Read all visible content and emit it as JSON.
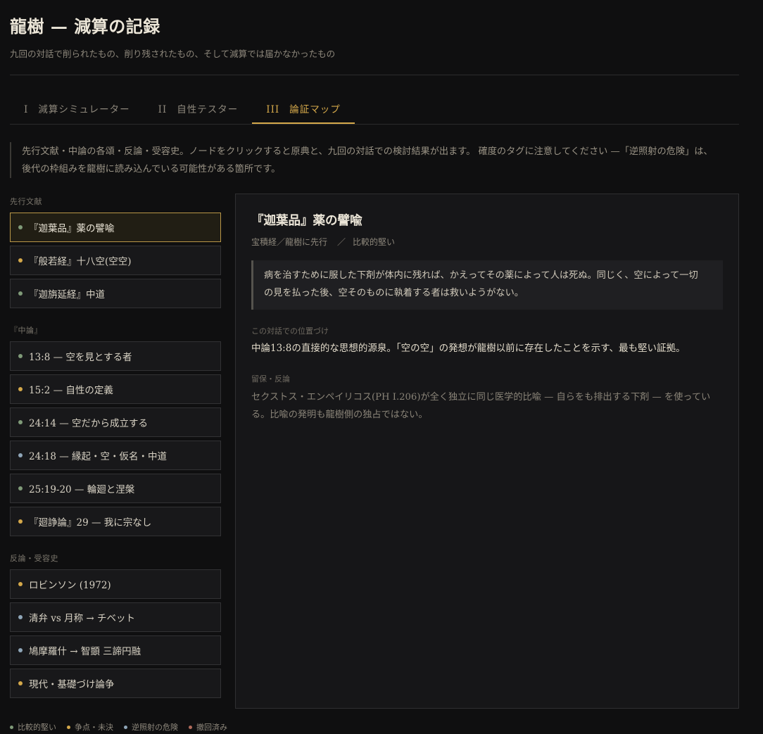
{
  "header": {
    "title": "龍樹 — 減算の記録",
    "subtitle": "九回の対話で削られたもの、削り残されたもの、そして減算では届かなかったもの"
  },
  "tabs": [
    {
      "num": "I",
      "label": "減算シミュレーター"
    },
    {
      "num": "II",
      "label": "自性テスター"
    },
    {
      "num": "III",
      "label": "論証マップ"
    }
  ],
  "intro": {
    "line1": "先行文献・中論の各頌・反論・受容史。ノードをクリックすると原典と、九回の対話での検討結果が出ます。 確度のタグに注意してください —「逆照射の危険」は、",
    "line2": "後代の枠組みを龍樹に読み込んでいる可能性がある箇所です。"
  },
  "colors": {
    "firm": "#7f9a78",
    "disputed": "#d4a84a",
    "risk": "#8fa6b8",
    "retracted": "#b06a5a",
    "accent": "#d4a84a"
  },
  "sections": [
    {
      "heading": "先行文献",
      "nodes": [
        {
          "label": "『迦葉品』薬の譬喩",
          "status": "firm"
        },
        {
          "label": "『般若経』十八空(空空)",
          "status": "disputed"
        },
        {
          "label": "『迦旃延経』中道",
          "status": "firm"
        }
      ]
    },
    {
      "heading": "『中論』",
      "nodes": [
        {
          "label": "13:8 — 空を見とする者",
          "status": "firm"
        },
        {
          "label": "15:2 — 自性の定義",
          "status": "disputed"
        },
        {
          "label": "24:14 — 空だから成立する",
          "status": "firm"
        },
        {
          "label": "24:18 — 縁起・空・仮名・中道",
          "status": "risk"
        },
        {
          "label": "25:19-20 — 輪廻と涅槃",
          "status": "firm"
        },
        {
          "label": "『廻諍論』29 — 我に宗なし",
          "status": "disputed"
        }
      ]
    },
    {
      "heading": "反論・受容史",
      "nodes": [
        {
          "label": "ロビンソン (1972)",
          "status": "disputed"
        },
        {
          "label": "清弁 vs 月称 → チベット",
          "status": "risk"
        },
        {
          "label": "鳩摩羅什 → 智顗 三諦円融",
          "status": "risk"
        },
        {
          "label": "現代・基礎づけ論争",
          "status": "disputed"
        }
      ]
    }
  ],
  "detail": {
    "title": "『迦葉品』薬の譬喩",
    "source": "宝積経／龍樹に先行",
    "separator": "／",
    "certainty": "比較的堅い",
    "quote_line1": "病を治すために服した下剤が体内に残れば、かえってその薬によって人は死ぬ。同じく、空によって一切",
    "quote_line2": "の見を払った後、空そのものに執着する者は救いようがない。",
    "position_label": "この対話での位置づけ",
    "position_text": "中論13:8の直接的な思想的源泉。「空の空」の発想が龍樹以前に存在したことを示す、最も堅い証拠。",
    "caveat_label": "留保・反論",
    "caveat_line1": "セクストス・エンペイリコス(PH I.206)が全く独立に同じ医学的比喩 — 自らをも排出する下剤 — を使ってい",
    "caveat_line2": "る。比喩の発明も龍樹側の独占ではない。"
  },
  "legend": [
    {
      "label": "比較的堅い",
      "status": "firm"
    },
    {
      "label": "争点・未決",
      "status": "disputed"
    },
    {
      "label": "逆照射の危険",
      "status": "risk"
    },
    {
      "label": "撤回済み",
      "status": "retracted"
    }
  ]
}
